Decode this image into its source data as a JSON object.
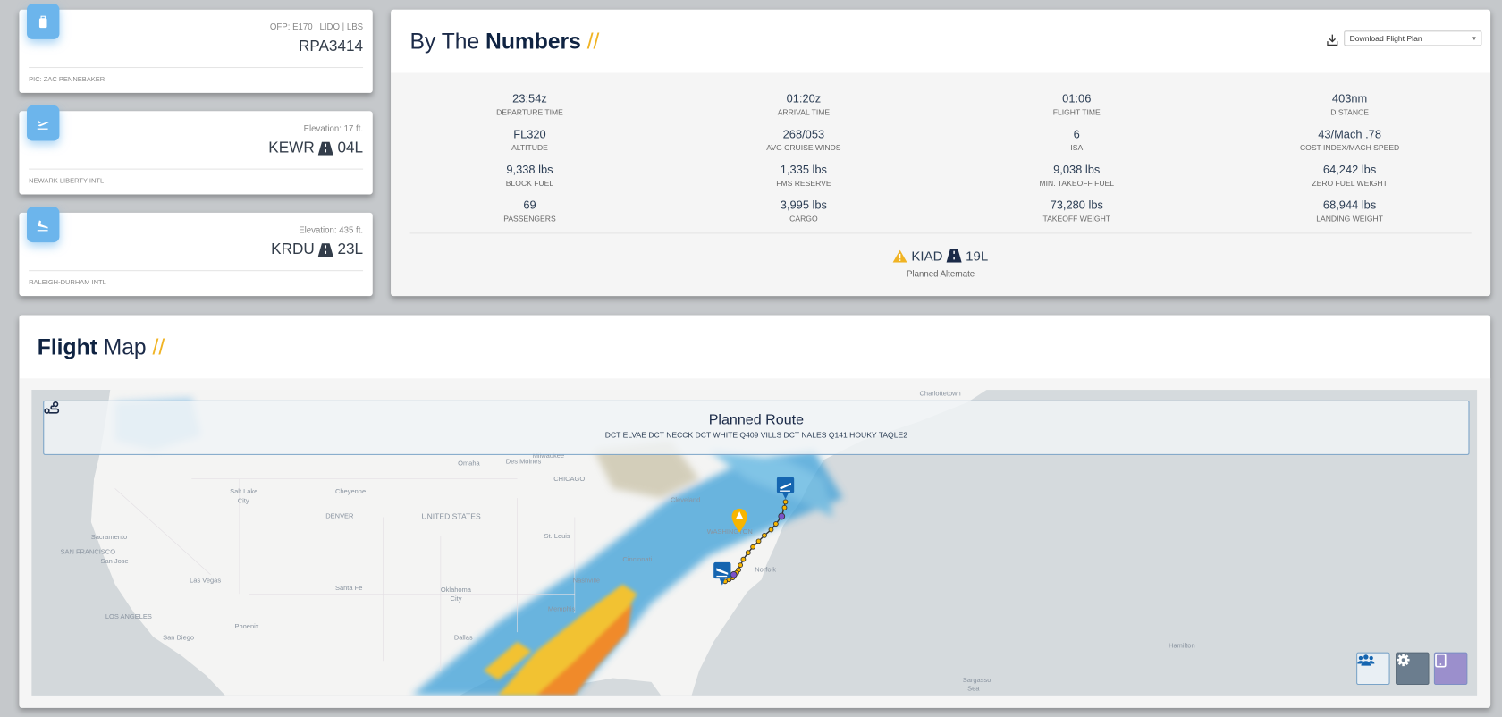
{
  "flight_card": {
    "ofp": "OFP: E170 | LIDO | LBS",
    "flight_number": "RPA3414",
    "pic": "PIC: ZAC PENNEBAKER",
    "icon": "luggage-icon"
  },
  "departure": {
    "elevation": "Elevation: 17 ft.",
    "airport": "KEWR",
    "runway": "04L",
    "name": "NEWARK LIBERTY INTL",
    "icon": "plane-departure-icon"
  },
  "arrival": {
    "elevation": "Elevation: 435 ft.",
    "airport": "KRDU",
    "runway": "23L",
    "name": "RALEIGH-DURHAM INTL",
    "icon": "plane-arrival-icon"
  },
  "numbers": {
    "title_a": "By The ",
    "title_b": "Numbers",
    "title_c": " //",
    "download_select": "Download Flight Plan",
    "stats": [
      {
        "value": "23:54z",
        "label": "DEPARTURE TIME"
      },
      {
        "value": "01:20z",
        "label": "ARRIVAL TIME"
      },
      {
        "value": "01:06",
        "label": "FLIGHT TIME"
      },
      {
        "value": "403nm",
        "label": "DISTANCE"
      },
      {
        "value": "FL320",
        "label": "ALTITUDE"
      },
      {
        "value": "268/053",
        "label": "AVG CRUISE WINDS"
      },
      {
        "value": "6",
        "label": "ISA"
      },
      {
        "value": "43/Mach .78",
        "label": "COST INDEX/MACH SPEED"
      },
      {
        "value": "9,338 lbs",
        "label": "BLOCK FUEL"
      },
      {
        "value": "1,335 lbs",
        "label": "FMS RESERVE"
      },
      {
        "value": "9,038 lbs",
        "label": "MIN. TAKEOFF FUEL"
      },
      {
        "value": "64,242 lbs",
        "label": "ZERO FUEL WEIGHT"
      },
      {
        "value": "69",
        "label": "PASSENGERS"
      },
      {
        "value": "3,995 lbs",
        "label": "CARGO"
      },
      {
        "value": "73,280 lbs",
        "label": "TAKEOFF WEIGHT"
      },
      {
        "value": "68,944 lbs",
        "label": "LANDING WEIGHT"
      }
    ],
    "alternate": {
      "airport": "KIAD",
      "runway": "19L",
      "label": "Planned Alternate"
    }
  },
  "map": {
    "title_a": "Flight",
    "title_b": " Map",
    "title_c": " //",
    "route_title": "Planned Route",
    "route": "DCT ELVAE DCT NECCK DCT WHITE Q409 VILLS DCT NALES Q141 HOUKY TAQLE2",
    "labels": [
      "Charlottetown",
      "Milwaukee",
      "CHICAGO",
      "Omaha",
      "Des Moines",
      "Cheyenne",
      "Salt Lake",
      "City",
      "DENVER",
      "UNITED STATES",
      "Sacramento",
      "SAN FRANCISCO",
      "San Jose",
      "Las Vegas",
      "Santa Fe",
      "Oklahoma",
      "City",
      "LOS ANGELES",
      "Phoenix",
      "San Diego",
      "Dallas",
      "Memphis",
      "Nashville",
      "St. Louis",
      "Cincinnati",
      "Cleveland",
      "WASHINGTON",
      "Norfolk",
      "Hamilton",
      "Sargasso",
      "Sea"
    ],
    "buttons": [
      {
        "name": "crew",
        "icon": "users-icon",
        "color": "#e9eff4"
      },
      {
        "name": "settings",
        "icon": "gear-icon",
        "color": "#6b7d8e"
      },
      {
        "name": "tablet",
        "icon": "tablet-icon",
        "color": "#9b8fcc"
      }
    ]
  },
  "colors": {
    "accent": "#f0b323",
    "icon_tile": "#6cb5ec",
    "navy": "#0f2342",
    "marker": "#1565b0"
  }
}
